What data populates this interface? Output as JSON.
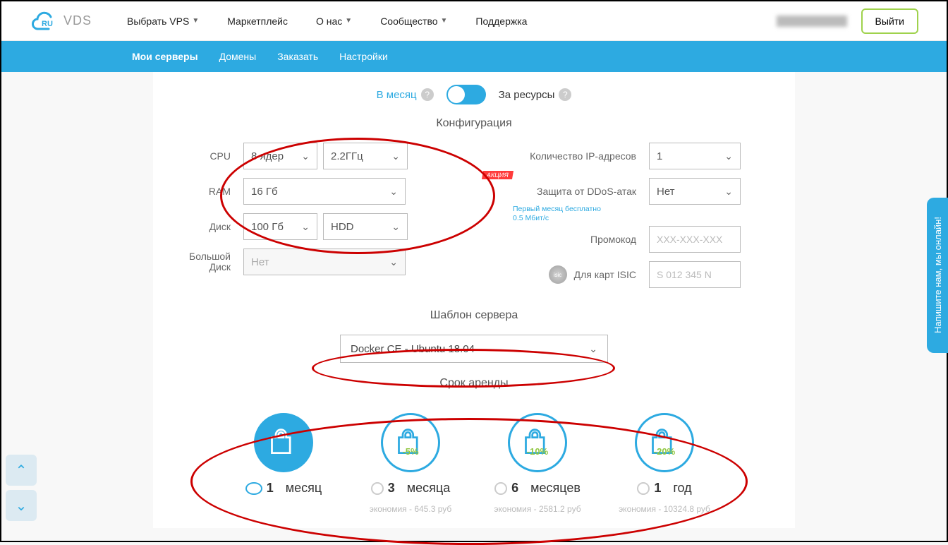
{
  "topnav": {
    "items": [
      "Выбрать VPS",
      "Маркетплейс",
      "О нас",
      "Сообщество",
      "Поддержка"
    ],
    "has_caret": [
      true,
      false,
      true,
      true,
      false
    ],
    "logout": "Выйти",
    "logo_ru": "RU",
    "logo_vds": "VDS"
  },
  "subnav": {
    "items": [
      "Мои серверы",
      "Домены",
      "Заказать",
      "Настройки"
    ],
    "active_index": 0
  },
  "billing": {
    "monthly": "В месяц",
    "resources": "За ресурсы"
  },
  "sections": {
    "config": "Конфигурация",
    "template": "Шаблон сервера",
    "rent": "Срок аренды"
  },
  "config_left": {
    "cpu_label": "CPU",
    "cpu_cores": "8 ядер",
    "cpu_freq": "2.2ГГц",
    "ram_label": "RAM",
    "ram_value": "16 Гб",
    "disk_label": "Диск",
    "disk_size": "100 Гб",
    "disk_type": "HDD",
    "bigdisk_label": "Большой Диск",
    "bigdisk_value": "Нет"
  },
  "config_right": {
    "ip_label": "Количество IP-адресов",
    "ip_value": "1",
    "ddos_label": "Защита от DDoS-атак",
    "ddos_value": "Нет",
    "ddos_note1": "Первый месяц бесплатно",
    "ddos_note2": "0.5 Мбит/с",
    "akcia": "АКЦИЯ",
    "promo_label": "Промокод",
    "promo_placeholder": "XXX-XXX-XXX",
    "isic_label": "Для карт ISIC",
    "isic_placeholder": "S 012 345 N",
    "isic_badge": "isic"
  },
  "template": {
    "value": "Docker CE - Ubuntu 18.04"
  },
  "rent": {
    "options": [
      {
        "period_num": "1",
        "period_unit": "месяц",
        "discount": "",
        "savings": ""
      },
      {
        "period_num": "3",
        "period_unit": "месяца",
        "discount": "-5%",
        "savings": "экономия - 645.3 руб"
      },
      {
        "period_num": "6",
        "period_unit": "месяцев",
        "discount": "-10%",
        "savings": "экономия - 2581.2 руб"
      },
      {
        "period_num": "1",
        "period_unit": "год",
        "discount": "-20%",
        "savings": "экономия - 10324.8 руб"
      }
    ],
    "selected_index": 0
  },
  "chat": {
    "label": "Напишите нам, мы онлайн!"
  }
}
